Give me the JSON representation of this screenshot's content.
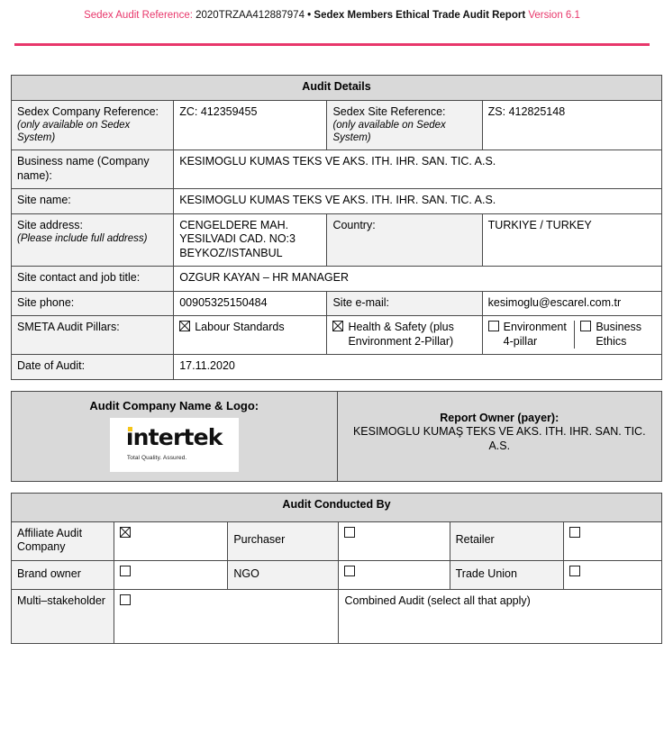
{
  "header": {
    "ref_label": "Sedex Audit Reference:",
    "ref_value": "2020TRZAA412887974",
    "separator": "•",
    "report_title": "Sedex Members Ethical Trade Audit Report",
    "version": "Version 6.1",
    "accent_color": "#e8376b"
  },
  "audit_details": {
    "band_title": "Audit Details",
    "company_ref_label": "Sedex Company Reference:",
    "company_ref_note": "(only available on Sedex System)",
    "company_ref_value": "ZC: 412359455",
    "site_ref_label": "Sedex Site Reference:",
    "site_ref_note": "(only available on Sedex System)",
    "site_ref_value": "ZS: 412825148",
    "business_name_label": "Business name (Company name):",
    "business_name_value": "KESIMOGLU KUMAS TEKS VE AKS. ITH. IHR. SAN. TIC. A.S.",
    "site_name_label": "Site name:",
    "site_name_value": "KESIMOGLU KUMAS TEKS VE AKS. ITH. IHR. SAN. TIC. A.S.",
    "site_address_label": "Site address:",
    "site_address_note": "(Please include full address)",
    "site_address_value": "CENGELDERE MAH. YESILVADI CAD. NO:3 BEYKOZ/ISTANBUL",
    "country_label": "Country:",
    "country_value": "TURKIYE / TURKEY",
    "site_contact_label": "Site contact and job title:",
    "site_contact_value": "OZGUR KAYAN – HR MANAGER",
    "site_phone_label": "Site phone:",
    "site_phone_value": "00905325150484",
    "site_email_label": "Site e-mail:",
    "site_email_value": "kesimoglu@escarel.com.tr",
    "pillars_label": "SMETA Audit Pillars:",
    "pillars": [
      {
        "label": "Labour Standards",
        "checked": true
      },
      {
        "label": "Health & Safety (plus Environment 2-Pillar)",
        "checked": true
      },
      {
        "label": "Environment 4-pillar",
        "checked": false
      },
      {
        "label": "Business Ethics",
        "checked": false
      }
    ],
    "date_label": "Date of Audit:",
    "date_value": "17.11.2020"
  },
  "audit_company": {
    "title": "Audit Company Name & Logo:",
    "logo_word": "intertek",
    "logo_tagline": "Total Quality. Assured.",
    "logo_dot_color": "#f5c518",
    "owner_title": "Report Owner (payer):",
    "owner_value": "KESIMOGLU KUMAŞ TEKS VE AKS. ITH. IHR. SAN. TIC. A.S."
  },
  "conducted_by": {
    "band_title": "Audit Conducted By",
    "rows": [
      {
        "c1_label": "Affiliate Audit Company",
        "c1_checked": true,
        "c2_label": "Purchaser",
        "c2_checked": false,
        "c3_label": "Retailer",
        "c3_checked": false
      },
      {
        "c1_label": "Brand owner",
        "c1_checked": false,
        "c2_label": "NGO",
        "c2_checked": false,
        "c3_label": "Trade Union",
        "c3_checked": false
      }
    ],
    "multi_label": "Multi–stakeholder",
    "multi_checked": false,
    "combined_label": "Combined Audit (select all that apply)"
  }
}
